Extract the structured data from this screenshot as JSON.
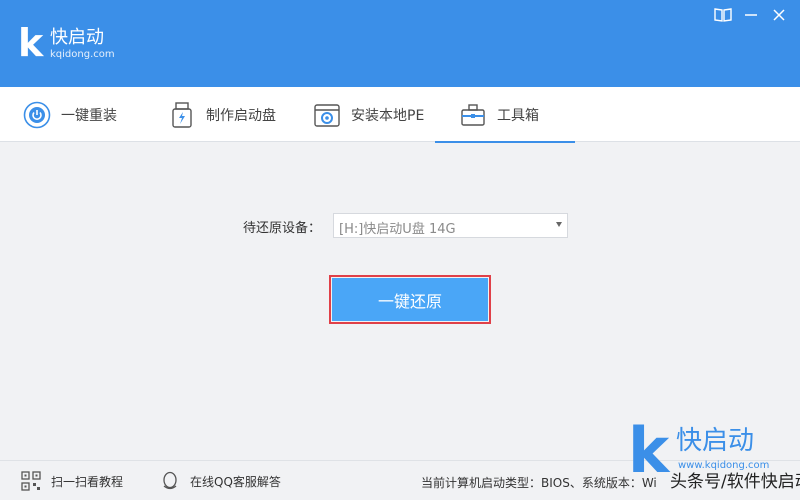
{
  "app": {
    "logo_letter": "k",
    "name": "快启动",
    "url": "kqidong.com"
  },
  "window_buttons": [
    {
      "icon": "book-icon"
    },
    {
      "icon": "minimize-icon"
    },
    {
      "icon": "close-icon"
    }
  ],
  "tabs": [
    {
      "label": "一键重装",
      "icon": "power-icon",
      "active": false
    },
    {
      "label": "制作启动盘",
      "icon": "usb-drive-icon",
      "active": false
    },
    {
      "label": "安装本地PE",
      "icon": "pe-install-icon",
      "active": false
    },
    {
      "label": "工具箱",
      "icon": "toolbox-icon",
      "active": true
    }
  ],
  "main": {
    "device_label": "待还原设备：",
    "device_value": "[H:]快启动U盘 14G",
    "restore_button": "一键还原"
  },
  "footer": {
    "qr_label": "扫一扫看教程",
    "qq_label": "在线QQ客服解答",
    "status_text": "当前计算机启动类型：BIOS、系统版本：Wi"
  },
  "watermark": {
    "letter": "k",
    "name": "快启动",
    "url": "www.kqidong.com",
    "caption": "头条号/软件快启动"
  },
  "colors": {
    "accent": "#3b8fe8",
    "button": "#4aa6f7",
    "highlight_outline": "#e04048"
  }
}
